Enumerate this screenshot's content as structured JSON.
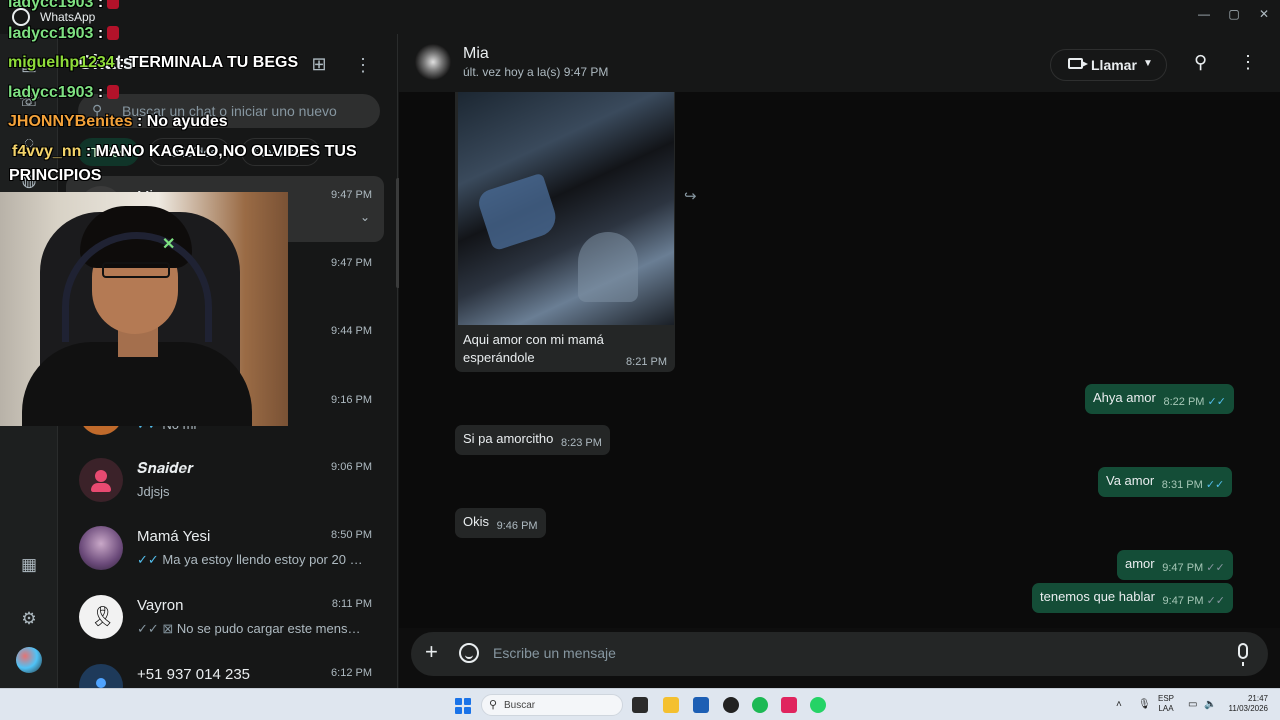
{
  "window": {
    "app_title": "WhatsApp",
    "min": "—",
    "max": "▢",
    "close": "✕"
  },
  "rail": {
    "icons": [
      "chats-icon",
      "calls-icon",
      "status-icon",
      "communities-icon",
      "media-icon",
      "settings-icon",
      "profile-avatar"
    ]
  },
  "sidebar": {
    "title": "Chats",
    "search_placeholder": "Buscar un chat o iniciar uno nuevo",
    "chips": [
      "Todos",
      "No leídos",
      "Favoritos"
    ],
    "chats": [
      {
        "name": "Mia",
        "time": "9:47 PM",
        "preview": "",
        "active": true
      },
      {
        "name": "",
        "time": "9:47 PM",
        "preview": ""
      },
      {
        "name": "",
        "time": "9:44 PM",
        "preview": ""
      },
      {
        "name": "",
        "time": "9:16 PM",
        "preview": "No mi"
      },
      {
        "name": "𝑺𝒏𝒂𝒊𝒅𝒆𝒓",
        "time": "9:06 PM",
        "preview": "Jdjsjs"
      },
      {
        "name": "Mamá Yesi",
        "time": "8:50 PM",
        "preview": "Ma ya estoy llendo estoy por 20 aho..."
      },
      {
        "name": "Vayron",
        "time": "8:11 PM",
        "preview": "No se pudo cargar este mensaje..."
      },
      {
        "name": "+51 937 014 235",
        "time": "6:12 PM",
        "preview": ""
      }
    ]
  },
  "header": {
    "name": "Mia",
    "status": "últ. vez hoy a la(s) 9:47 PM",
    "call_label": "Llamar"
  },
  "messages": {
    "image_caption": "Aqui amor con mi mamá esperándole",
    "image_time": "8:21 PM",
    "items": [
      {
        "text": "Ahya amor",
        "time": "8:22 PM",
        "dir": "out"
      },
      {
        "text": "Si pa amorcitho",
        "time": "8:23 PM",
        "dir": "in"
      },
      {
        "text": "Va amor",
        "time": "8:31 PM",
        "dir": "out"
      },
      {
        "text": "Okis",
        "time": "9:46 PM",
        "dir": "in"
      },
      {
        "text": "amor",
        "time": "9:47 PM",
        "dir": "out"
      },
      {
        "text": "tenemos que hablar",
        "time": "9:47 PM",
        "dir": "out"
      }
    ]
  },
  "composer": {
    "placeholder": "Escribe un mensaje"
  },
  "overlay_chat": [
    {
      "user": "ladycc1903",
      "msg": ":",
      "color": "#7ee081"
    },
    {
      "user": "ladycc1903",
      "msg": ":",
      "color": "#7ee081"
    },
    {
      "user": "miguelhp1234",
      "msg": ": TERMINALA TU BEGS",
      "color": "#8fdc3a"
    },
    {
      "user": "ladycc1903",
      "msg": ":",
      "color": "#7ee081"
    },
    {
      "user": "JHONNYBenites",
      "msg": ": No ayudes",
      "color": "#f3a23a"
    },
    {
      "user": "f4vvy_nn",
      "msg": ": MANO KAGALO,NO OLVIDES TUS",
      "color": "#f3d36a"
    },
    {
      "user": "",
      "msg": "PRINCIPIOS",
      "color": "#ffffff"
    }
  ],
  "taskbar": {
    "search_label": "Buscar",
    "lang_top": "ESP",
    "lang_bottom": "LAA",
    "clock_time": "21:47",
    "clock_date": "11/03/2026"
  },
  "colors": {
    "accent_green": "#144d37",
    "tick_blue": "#53bdeb",
    "bg": "#0b0b0b"
  }
}
